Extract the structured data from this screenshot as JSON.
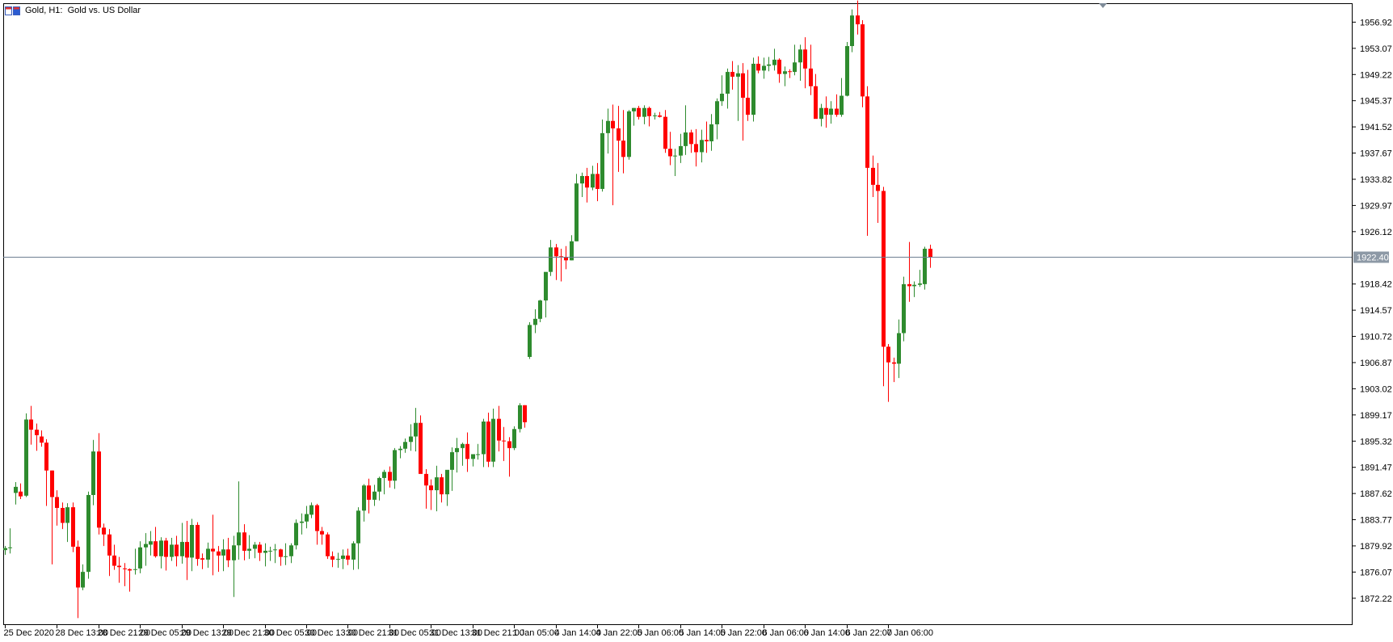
{
  "header": {
    "icon": "candlestick-chart-icon",
    "title": "Gold, H1:  Gold vs. US Dollar"
  },
  "colors": {
    "bull": "#2e8b2e",
    "bear": "#ff0000",
    "price_line": "#6e7f92",
    "price_label_bg": "#8d99a6",
    "frame": "#000000"
  },
  "chart_data": {
    "type": "candlestick",
    "title": "Gold, H1:  Gold vs. US Dollar",
    "ylim": [
      1868.4,
      1959.7
    ],
    "current_price": 1922.4,
    "current_price_label": "1922.40",
    "grid": false,
    "y_ticks": [
      "1956.92",
      "1953.07",
      "1949.22",
      "1945.37",
      "1941.52",
      "1937.67",
      "1933.82",
      "1929.97",
      "1926.12",
      "1918.42",
      "1914.57",
      "1910.72",
      "1906.87",
      "1903.02",
      "1899.17",
      "1895.32",
      "1891.47",
      "1887.62",
      "1883.77",
      "1879.92",
      "1876.07",
      "1872.22"
    ],
    "x_ticks": [
      {
        "label": "25 Dec 2020",
        "index": 0
      },
      {
        "label": "28 Dec 13:00",
        "index": 10
      },
      {
        "label": "28 Dec 21:00",
        "index": 18
      },
      {
        "label": "29 Dec 05:00",
        "index": 26
      },
      {
        "label": "29 Dec 13:00",
        "index": 34
      },
      {
        "label": "29 Dec 21:00",
        "index": 42
      },
      {
        "label": "30 Dec 05:00",
        "index": 50
      },
      {
        "label": "30 Dec 13:00",
        "index": 58
      },
      {
        "label": "30 Dec 21:00",
        "index": 66
      },
      {
        "label": "31 Dec 05:00",
        "index": 74
      },
      {
        "label": "31 Dec 13:00",
        "index": 82
      },
      {
        "label": "31 Dec 21:00",
        "index": 90
      },
      {
        "label": "1 Jan 05:00",
        "index": 98
      },
      {
        "label": "4 Jan 14:00",
        "index": 106
      },
      {
        "label": "4 Jan 22:00",
        "index": 114
      },
      {
        "label": "5 Jan 06:00",
        "index": 122
      },
      {
        "label": "5 Jan 14:00",
        "index": 130
      },
      {
        "label": "5 Jan 22:00",
        "index": 138
      },
      {
        "label": "6 Jan 06:00",
        "index": 146
      },
      {
        "label": "6 Jan 14:00",
        "index": 154
      },
      {
        "label": "6 Jan 22:00",
        "index": 162
      },
      {
        "label": "7 Jan 06:00",
        "index": 170
      }
    ],
    "ohlc": [
      [
        1879.3,
        1879.9,
        1878.6,
        1879.6
      ],
      [
        1879.6,
        1882.5,
        1878.8,
        1879.7
      ],
      [
        1887.7,
        1889.3,
        1886.0,
        1888.6
      ],
      [
        1887.9,
        1889.1,
        1886.8,
        1887.2
      ],
      [
        1887.3,
        1899.4,
        1887.1,
        1898.5
      ],
      [
        1898.5,
        1900.5,
        1894.8,
        1897.0
      ],
      [
        1897.0,
        1897.9,
        1893.9,
        1896.2
      ],
      [
        1896.0,
        1896.9,
        1894.5,
        1895.1
      ],
      [
        1895.1,
        1895.6,
        1885.8,
        1891.0
      ],
      [
        1891.0,
        1891.0,
        1877.2,
        1887.1
      ],
      [
        1887.1,
        1888.1,
        1882.9,
        1885.5
      ],
      [
        1885.5,
        1886.3,
        1882.4,
        1883.3
      ],
      [
        1883.3,
        1886.2,
        1880.5,
        1885.6
      ],
      [
        1885.6,
        1886.3,
        1879.0,
        1879.8
      ],
      [
        1879.8,
        1880.7,
        1869.3,
        1873.8
      ],
      [
        1873.8,
        1877.2,
        1873.4,
        1876.1
      ],
      [
        1876.1,
        1887.9,
        1875.1,
        1887.4
      ],
      [
        1887.4,
        1895.5,
        1885.9,
        1893.8
      ],
      [
        1893.8,
        1896.5,
        1881.6,
        1882.6
      ],
      [
        1882.6,
        1883.2,
        1879.9,
        1881.6
      ],
      [
        1881.6,
        1882.4,
        1875.5,
        1878.5
      ],
      [
        1878.5,
        1880.1,
        1876.4,
        1877.0
      ],
      [
        1877.0,
        1878.3,
        1874.5,
        1876.8
      ],
      [
        1876.6,
        1877.4,
        1874.0,
        1876.5
      ],
      [
        1876.5,
        1876.6,
        1873.2,
        1876.3
      ],
      [
        1876.4,
        1879.5,
        1875.7,
        1876.5
      ],
      [
        1876.6,
        1880.6,
        1875.9,
        1879.7
      ],
      [
        1879.7,
        1881.8,
        1877.0,
        1880.2
      ],
      [
        1880.1,
        1882.1,
        1878.5,
        1880.6
      ],
      [
        1880.6,
        1882.7,
        1878.2,
        1878.4
      ],
      [
        1878.4,
        1881.2,
        1876.6,
        1880.7
      ],
      [
        1880.7,
        1881.1,
        1876.3,
        1878.3
      ],
      [
        1878.3,
        1881.1,
        1877.7,
        1880.1
      ],
      [
        1880.1,
        1881.4,
        1876.9,
        1878.4
      ],
      [
        1878.4,
        1883.3,
        1877.3,
        1880.5
      ],
      [
        1880.5,
        1883.6,
        1874.9,
        1878.2
      ],
      [
        1878.2,
        1883.9,
        1876.2,
        1883.0
      ],
      [
        1883.0,
        1883.4,
        1877.0,
        1878.0
      ],
      [
        1878.1,
        1878.8,
        1876.5,
        1877.9
      ],
      [
        1877.9,
        1880.4,
        1876.7,
        1879.5
      ],
      [
        1879.5,
        1884.5,
        1875.6,
        1879.1
      ],
      [
        1879.1,
        1879.9,
        1876.1,
        1878.5
      ],
      [
        1878.5,
        1880.9,
        1876.2,
        1879.4
      ],
      [
        1879.4,
        1881.1,
        1876.8,
        1877.8
      ],
      [
        1877.8,
        1881.4,
        1872.4,
        1880.0
      ],
      [
        1880.0,
        1889.4,
        1877.9,
        1881.9
      ],
      [
        1881.9,
        1883.1,
        1877.8,
        1879.2
      ],
      [
        1879.2,
        1881.5,
        1878.0,
        1879.5
      ],
      [
        1879.5,
        1880.5,
        1878.1,
        1880.1
      ],
      [
        1880.1,
        1880.5,
        1877.7,
        1878.9
      ],
      [
        1878.9,
        1880.3,
        1876.9,
        1879.2
      ],
      [
        1879.1,
        1879.8,
        1877.7,
        1879.2
      ],
      [
        1879.3,
        1880.2,
        1877.4,
        1879.4
      ],
      [
        1879.4,
        1879.5,
        1877.0,
        1878.3
      ],
      [
        1878.3,
        1880.3,
        1877.1,
        1878.4
      ],
      [
        1878.4,
        1880.3,
        1877.4,
        1880.0
      ],
      [
        1880.0,
        1883.8,
        1879.4,
        1883.3
      ],
      [
        1883.3,
        1884.7,
        1881.6,
        1883.5
      ],
      [
        1883.5,
        1885.8,
        1882.5,
        1884.6
      ],
      [
        1884.5,
        1886.3,
        1884.0,
        1885.9
      ],
      [
        1885.9,
        1886.1,
        1880.1,
        1882.1
      ],
      [
        1882.1,
        1882.7,
        1880.1,
        1881.6
      ],
      [
        1881.6,
        1881.9,
        1878.0,
        1878.4
      ],
      [
        1878.4,
        1879.1,
        1876.8,
        1877.9
      ],
      [
        1877.9,
        1878.9,
        1876.7,
        1878.0
      ],
      [
        1878.0,
        1879.4,
        1876.5,
        1878.5
      ],
      [
        1878.5,
        1879.5,
        1877.1,
        1877.9
      ],
      [
        1877.9,
        1880.6,
        1876.4,
        1880.3
      ],
      [
        1880.3,
        1885.6,
        1876.5,
        1885.1
      ],
      [
        1885.1,
        1889.0,
        1883.5,
        1888.8
      ],
      [
        1888.8,
        1889.8,
        1884.7,
        1886.7
      ],
      [
        1886.7,
        1888.9,
        1885.8,
        1887.9
      ],
      [
        1887.9,
        1890.1,
        1886.6,
        1889.9
      ],
      [
        1889.9,
        1891.1,
        1887.5,
        1890.8
      ],
      [
        1890.8,
        1891.6,
        1888.5,
        1889.5
      ],
      [
        1889.5,
        1894.3,
        1888.3,
        1894.0
      ],
      [
        1894.0,
        1894.6,
        1892.8,
        1894.2
      ],
      [
        1894.2,
        1895.7,
        1893.6,
        1895.2
      ],
      [
        1895.2,
        1897.8,
        1893.9,
        1896.0
      ],
      [
        1896.0,
        1900.2,
        1893.8,
        1898.0
      ],
      [
        1898.0,
        1899.1,
        1890.8,
        1890.5
      ],
      [
        1890.5,
        1891.2,
        1885.4,
        1888.8
      ],
      [
        1888.8,
        1889.7,
        1885.2,
        1888.1
      ],
      [
        1888.1,
        1891.7,
        1885.0,
        1890.0
      ],
      [
        1890.0,
        1890.5,
        1886.3,
        1887.5
      ],
      [
        1887.5,
        1891.0,
        1885.8,
        1891.1
      ],
      [
        1891.1,
        1894.4,
        1888.0,
        1893.7
      ],
      [
        1893.7,
        1895.8,
        1890.7,
        1894.3
      ],
      [
        1894.3,
        1895.1,
        1891.7,
        1894.9
      ],
      [
        1894.9,
        1896.6,
        1890.8,
        1892.7
      ],
      [
        1892.7,
        1893.0,
        1891.6,
        1893.4
      ],
      [
        1893.4,
        1894.9,
        1892.6,
        1893.4
      ],
      [
        1893.4,
        1898.6,
        1891.5,
        1898.2
      ],
      [
        1898.2,
        1899.5,
        1891.5,
        1892.3
      ],
      [
        1892.3,
        1900.1,
        1891.5,
        1898.6
      ],
      [
        1898.6,
        1900.5,
        1893.8,
        1895.4
      ],
      [
        1895.4,
        1897.4,
        1892.4,
        1895.3
      ],
      [
        1895.3,
        1895.9,
        1890.1,
        1894.3
      ],
      [
        1894.3,
        1897.5,
        1894.0,
        1897.1
      ],
      [
        1897.1,
        1900.9,
        1896.6,
        1900.6
      ],
      [
        1900.6,
        1900.6,
        1897.3,
        1898.1
      ],
      [
        1907.7,
        1912.8,
        1907.4,
        1912.4
      ],
      [
        1912.4,
        1914.7,
        1911.2,
        1913.3
      ],
      [
        1913.3,
        1916.1,
        1912.8,
        1916.0
      ],
      [
        1916.0,
        1919.2,
        1913.5,
        1920.2
      ],
      [
        1920.2,
        1924.9,
        1919.6,
        1923.8
      ],
      [
        1923.8,
        1924.3,
        1919.0,
        1922.5
      ],
      [
        1922.5,
        1923.6,
        1918.8,
        1922.4
      ],
      [
        1922.4,
        1924.0,
        1920.6,
        1921.9
      ],
      [
        1921.9,
        1925.6,
        1921.9,
        1924.7
      ],
      [
        1924.7,
        1934.6,
        1924.7,
        1933.2
      ],
      [
        1933.2,
        1934.8,
        1931.2,
        1934.3
      ],
      [
        1934.3,
        1935.5,
        1930.4,
        1932.6
      ],
      [
        1932.6,
        1935.8,
        1932.2,
        1934.6
      ],
      [
        1934.6,
        1936.2,
        1930.6,
        1932.4
      ],
      [
        1932.4,
        1942.6,
        1932.0,
        1940.6
      ],
      [
        1940.6,
        1944.2,
        1937.6,
        1942.4
      ],
      [
        1942.4,
        1944.8,
        1930.0,
        1941.3
      ],
      [
        1941.3,
        1944.6,
        1934.9,
        1939.5
      ],
      [
        1939.5,
        1944.0,
        1934.7,
        1937.1
      ],
      [
        1937.1,
        1944.0,
        1936.7,
        1943.8
      ],
      [
        1943.8,
        1944.3,
        1941.7,
        1944.3
      ],
      [
        1944.3,
        1944.6,
        1942.6,
        1943.0
      ],
      [
        1943.0,
        1944.7,
        1941.9,
        1944.3
      ],
      [
        1944.3,
        1944.5,
        1941.6,
        1943.1
      ],
      [
        1943.1,
        1943.6,
        1942.6,
        1943.2
      ],
      [
        1943.2,
        1943.7,
        1942.9,
        1943.0
      ],
      [
        1943.0,
        1944.0,
        1937.7,
        1938.3
      ],
      [
        1938.3,
        1940.8,
        1935.9,
        1937.2
      ],
      [
        1937.2,
        1938.3,
        1934.3,
        1937.3
      ],
      [
        1937.3,
        1940.5,
        1936.2,
        1938.7
      ],
      [
        1938.7,
        1944.7,
        1937.4,
        1940.7
      ],
      [
        1940.7,
        1941.1,
        1937.7,
        1939.0
      ],
      [
        1939.0,
        1941.2,
        1935.7,
        1937.8
      ],
      [
        1937.8,
        1941.1,
        1936.3,
        1939.6
      ],
      [
        1939.6,
        1942.3,
        1937.7,
        1939.4
      ],
      [
        1939.4,
        1943.4,
        1938.0,
        1941.9
      ],
      [
        1941.9,
        1945.7,
        1939.7,
        1945.3
      ],
      [
        1945.3,
        1949.1,
        1944.6,
        1946.4
      ],
      [
        1946.4,
        1950.1,
        1944.2,
        1949.6
      ],
      [
        1949.6,
        1951.2,
        1947.0,
        1948.9
      ],
      [
        1948.9,
        1950.6,
        1942.4,
        1949.4
      ],
      [
        1949.4,
        1950.9,
        1939.5,
        1945.8
      ],
      [
        1945.8,
        1949.9,
        1942.4,
        1943.3
      ],
      [
        1943.3,
        1951.7,
        1942.3,
        1950.8
      ],
      [
        1950.8,
        1951.9,
        1949.4,
        1949.8
      ],
      [
        1949.8,
        1951.7,
        1948.6,
        1950.5
      ],
      [
        1950.5,
        1951.8,
        1949.7,
        1950.7
      ],
      [
        1950.6,
        1953.0,
        1949.8,
        1951.4
      ],
      [
        1951.4,
        1951.6,
        1948.0,
        1949.3
      ],
      [
        1949.3,
        1950.4,
        1947.5,
        1949.7
      ],
      [
        1949.7,
        1950.0,
        1948.7,
        1949.6
      ],
      [
        1949.6,
        1953.6,
        1949.1,
        1951.0
      ],
      [
        1951.0,
        1953.6,
        1948.3,
        1952.9
      ],
      [
        1952.9,
        1954.7,
        1947.2,
        1950.1
      ],
      [
        1950.1,
        1953.6,
        1946.2,
        1947.5
      ],
      [
        1947.5,
        1949.3,
        1942.8,
        1942.7
      ],
      [
        1942.7,
        1944.9,
        1941.6,
        1944.3
      ],
      [
        1944.3,
        1946.0,
        1941.4,
        1943.3
      ],
      [
        1943.3,
        1945.3,
        1942.0,
        1944.2
      ],
      [
        1944.2,
        1946.3,
        1943.0,
        1943.3
      ],
      [
        1943.3,
        1948.7,
        1943.0,
        1946.1
      ],
      [
        1946.1,
        1954.0,
        1946.0,
        1953.4
      ],
      [
        1953.4,
        1958.8,
        1952.5,
        1957.9
      ],
      [
        1957.9,
        1960.1,
        1955.1,
        1956.6
      ],
      [
        1956.6,
        1957.2,
        1944.4,
        1946.0
      ],
      [
        1946.0,
        1947.5,
        1925.5,
        1935.5
      ],
      [
        1935.5,
        1937.3,
        1931.2,
        1933.0
      ],
      [
        1933.0,
        1936.2,
        1927.4,
        1932.1
      ],
      [
        1932.1,
        1932.7,
        1903.4,
        1909.2
      ],
      [
        1909.2,
        1909.6,
        1901.1,
        1906.9
      ],
      [
        1906.9,
        1907.6,
        1904.0,
        1906.7
      ],
      [
        1906.7,
        1913.2,
        1904.6,
        1911.2
      ],
      [
        1911.2,
        1919.5,
        1910.0,
        1918.4
      ],
      [
        1918.4,
        1924.6,
        1915.8,
        1918.1
      ],
      [
        1918.1,
        1918.8,
        1916.5,
        1918.3
      ],
      [
        1918.3,
        1920.5,
        1918.0,
        1918.5
      ],
      [
        1918.4,
        1923.9,
        1917.6,
        1923.6
      ],
      [
        1923.6,
        1924.2,
        1920.8,
        1922.4
      ]
    ]
  }
}
